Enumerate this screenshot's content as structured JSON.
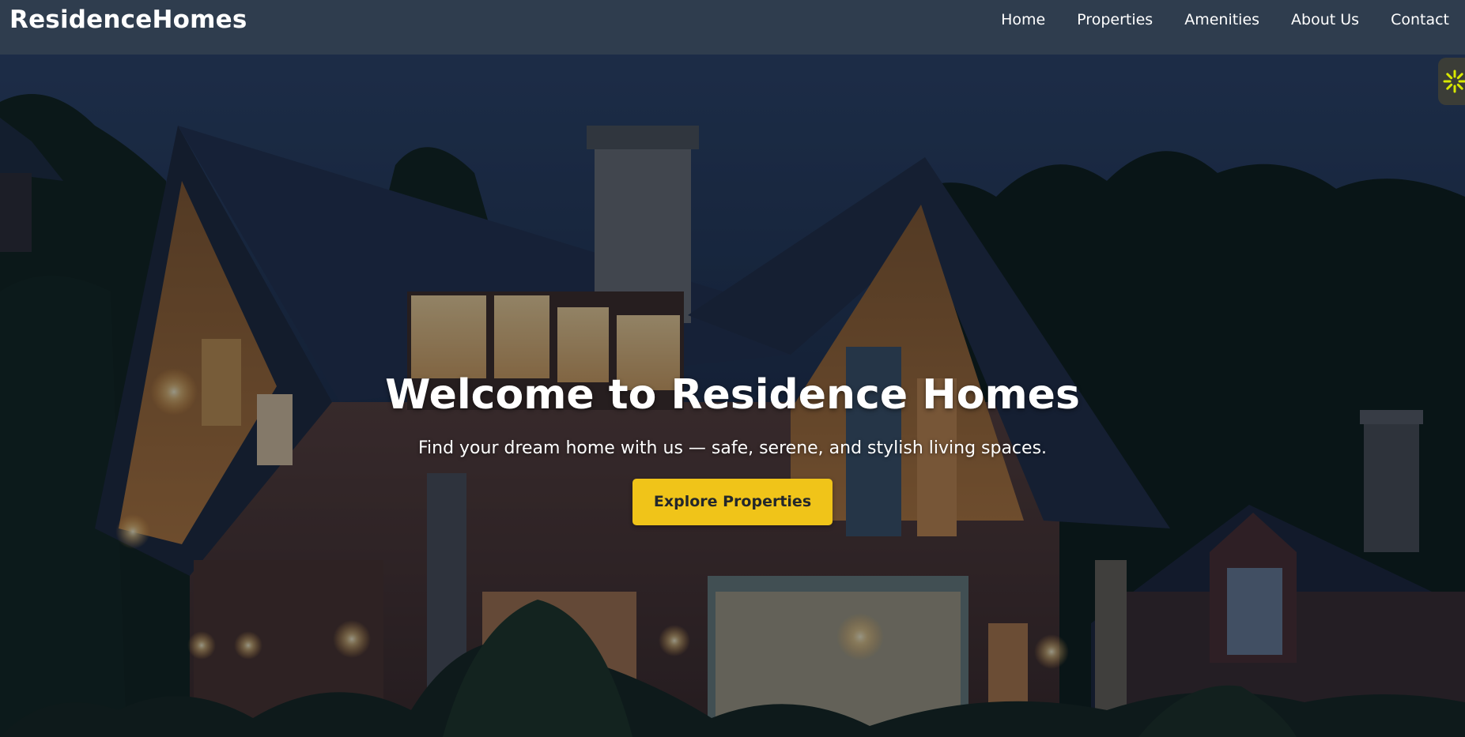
{
  "brand": {
    "name": "ResidenceHomes"
  },
  "nav": {
    "items": [
      {
        "label": "Home"
      },
      {
        "label": "Properties"
      },
      {
        "label": "Amenities"
      },
      {
        "label": "About Us"
      },
      {
        "label": "Contact"
      }
    ]
  },
  "hero": {
    "title": "Welcome to Residence Homes",
    "subtitle": "Find your dream home with us — safe, serene, and stylish living spaces.",
    "cta_label": "Explore Properties",
    "background_image": "night-house-photo"
  },
  "widget": {
    "icon": "sun-icon",
    "color": "#d8e800"
  },
  "colors": {
    "navbar_bg": "#2f3d4e",
    "cta_bg": "#f0c419",
    "cta_text": "#23272b",
    "text": "#ffffff"
  }
}
